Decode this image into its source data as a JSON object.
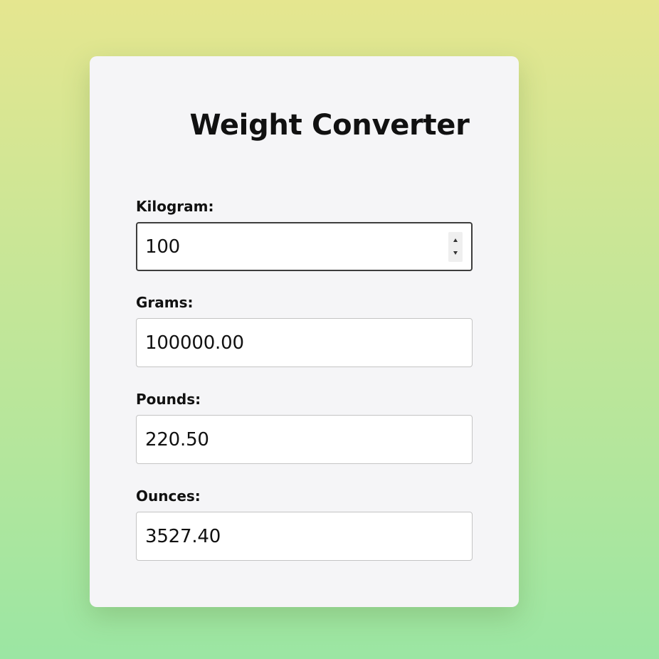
{
  "title": "Weight Converter",
  "fields": [
    {
      "label": "Kilogram:",
      "value": "100"
    },
    {
      "label": "Grams:",
      "value": "100000.00"
    },
    {
      "label": "Pounds:",
      "value": "220.50"
    },
    {
      "label": "Ounces:",
      "value": "3527.40"
    }
  ],
  "colors": {
    "background_top": "#e5e68f",
    "background_bottom": "#9be6a3",
    "card": "#f5f5f7",
    "text": "#111111"
  }
}
